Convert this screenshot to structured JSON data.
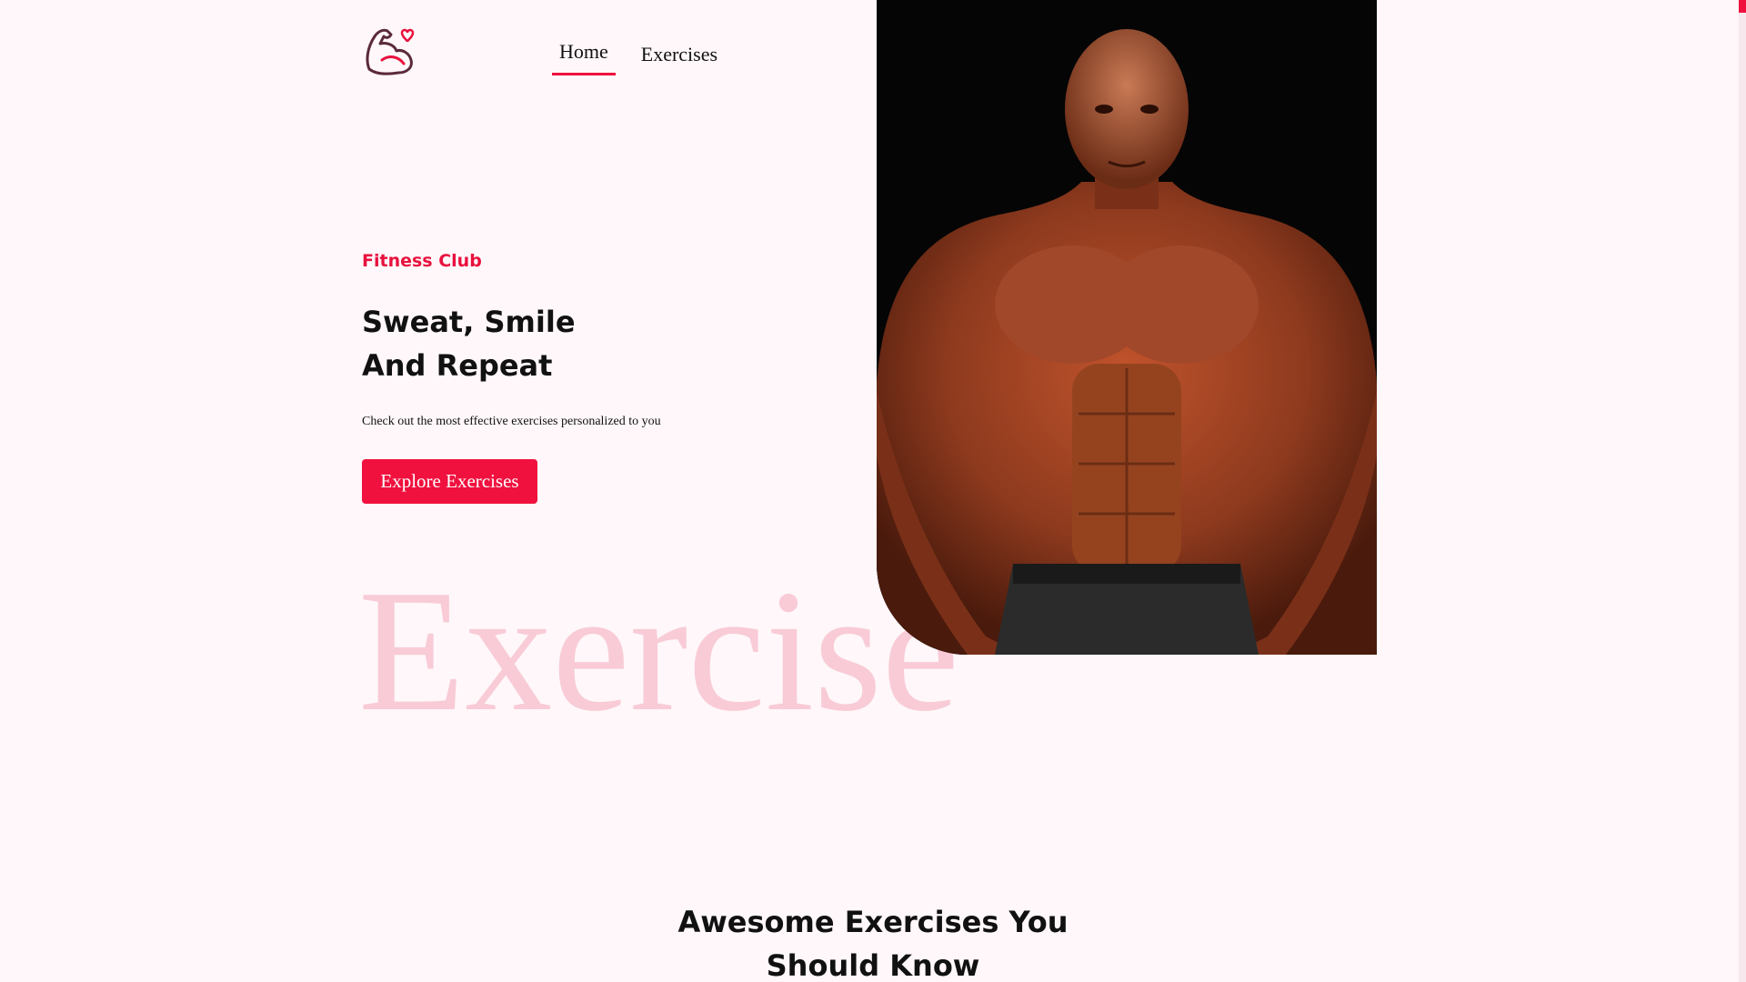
{
  "nav": {
    "logo_icon": "flexed-arm-heart-icon",
    "items": [
      {
        "label": "Home",
        "active": true
      },
      {
        "label": "Exercises",
        "active": false
      }
    ]
  },
  "hero": {
    "eyebrow": "Fitness Club",
    "headline_line1": "Sweat, Smile",
    "headline_line2": "And Repeat",
    "subtitle": "Check out the most effective exercises personalized to you",
    "cta_label": "Explore Exercises",
    "watermark": "Exercise",
    "image_alt": "bodybuilder"
  },
  "section": {
    "title_line1": "Awesome Exercises You",
    "title_line2": "Should Know"
  },
  "colors": {
    "accent": "#f0113e",
    "background": "#fff7f9",
    "watermark": "#f8cbd7"
  }
}
